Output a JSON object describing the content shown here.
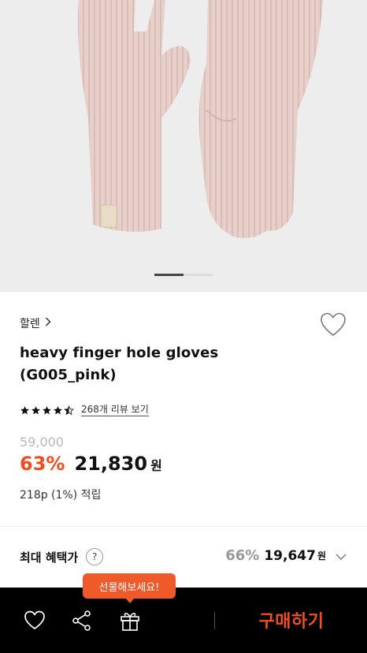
{
  "product": {
    "brand": "할렌",
    "title_line1": "heavy finger hole gloves",
    "title_line2": "(G005_pink)",
    "rating": 4.5,
    "review_link": "268개 리뷰 보기",
    "original_price": "59,000",
    "discount_rate": "63%",
    "sale_price": "21,830",
    "currency": "원",
    "points": "218p (1%) 적립"
  },
  "image_pager": {
    "current": 1,
    "total": 2
  },
  "benefit": {
    "label": "최대 혜택가",
    "help": "?",
    "rate": "66%",
    "price": "19,647",
    "unit": "원"
  },
  "bottom_bar": {
    "gift_tooltip": "선물해보세요!",
    "buy_label": "구매하기"
  },
  "colors": {
    "accent": "#f04e1e",
    "bar_bg": "#000000",
    "glove": "#e6cfc9"
  },
  "icons": {
    "brand_chevron": "chevron-right-icon",
    "wishlist": "heart-outline-icon",
    "star": "star-icon",
    "help": "question-icon",
    "expand": "chevron-down-icon",
    "share": "share-icon",
    "gift": "gift-icon"
  }
}
